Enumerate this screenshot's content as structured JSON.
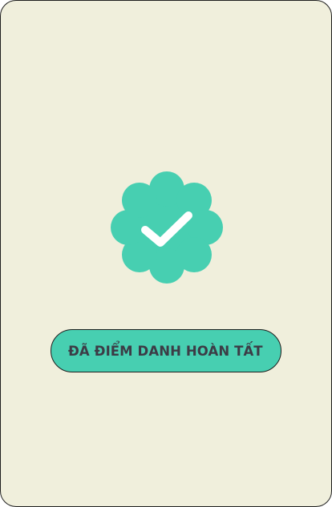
{
  "status": {
    "label": "ĐÃ ĐIỂM DANH HOÀN TẤT"
  },
  "icons": {
    "badge": "verified-check-badge-icon"
  },
  "colors": {
    "card_background": "#f0efdc",
    "accent": "#47cfb1",
    "check": "#ffffff",
    "label_text": "#3c3c46",
    "border": "#1e1e1e"
  }
}
